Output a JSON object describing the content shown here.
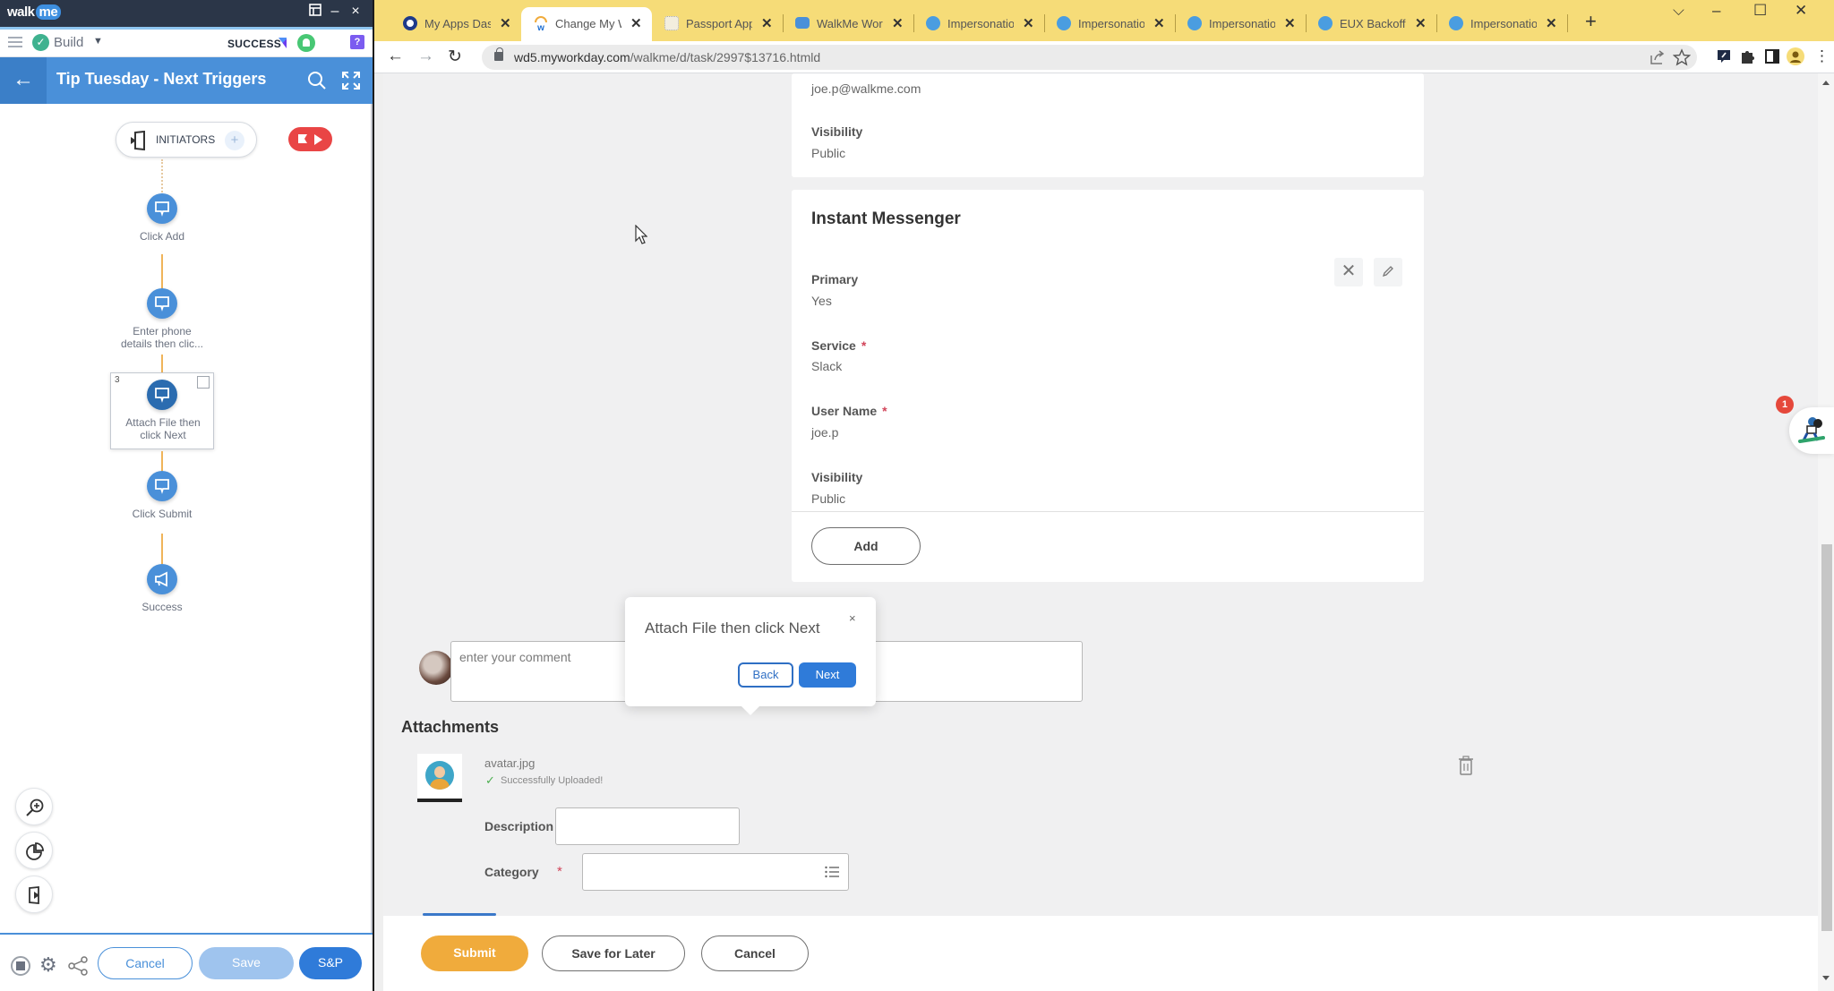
{
  "walkme": {
    "logo": "walk",
    "logo_me": "me",
    "build_label": "Build",
    "success_label": "SUCCESS",
    "help_label": "?",
    "flow_title": "Tip Tuesday - Next Triggers",
    "initiators_label": "INITIATORS",
    "initiators_add": "+",
    "steps": [
      {
        "label": "Click Add",
        "icon": "balloon-icon"
      },
      {
        "label": "Enter phone details then clic...",
        "icon": "balloon-icon"
      },
      {
        "label": "Attach File then click Next",
        "icon": "balloon-icon",
        "number": "3",
        "selected": true
      },
      {
        "label": "Click Submit",
        "icon": "balloon-icon"
      },
      {
        "label": "Success",
        "icon": "megaphone-icon"
      }
    ],
    "footer": {
      "cancel": "Cancel",
      "save": "Save",
      "save_publish": "S&P"
    }
  },
  "browser": {
    "tabs": [
      {
        "title": "My Apps Dashboard",
        "icon": "okta-icon",
        "active": false
      },
      {
        "title": "Change My Work Contact",
        "icon": "workday-icon",
        "active": true
      },
      {
        "title": "Passport Application",
        "icon": "passport-icon",
        "active": false
      },
      {
        "title": "WalkMe Workstation",
        "icon": "walkme-icon",
        "active": false
      },
      {
        "title": "Impersonation",
        "icon": "workday-w-icon",
        "active": false
      },
      {
        "title": "Impersonation",
        "icon": "workday-w-icon",
        "active": false
      },
      {
        "title": "Impersonation",
        "icon": "workday-w-icon",
        "active": false
      },
      {
        "title": "EUX Backoffice",
        "icon": "workday-w-icon",
        "active": false
      },
      {
        "title": "Impersonation",
        "icon": "workday-w-icon",
        "active": false
      }
    ],
    "url_host": "wd5.myworkday.com",
    "url_path": "/walkme/d/task/2997$13716.htmld",
    "brand_colors": {
      "tabstrip": "#f6dc78",
      "workday_primary": "#f0ab3c"
    }
  },
  "page": {
    "email_card": {
      "email_value": "joe.p@walkme.com",
      "visibility_label": "Visibility",
      "visibility_value": "Public"
    },
    "im_card": {
      "title": "Instant Messenger",
      "primary_label": "Primary",
      "primary_value": "Yes",
      "service_label": "Service",
      "service_value": "Slack",
      "username_label": "User Name",
      "username_value": "joe.p",
      "visibility_label": "Visibility",
      "visibility_value": "Public",
      "required_mark": "*",
      "add_button": "Add"
    },
    "comment_placeholder": "enter your comment",
    "attachments": {
      "heading": "Attachments",
      "file_name": "avatar.jpg",
      "status": "Successfully Uploaded!",
      "description_label": "Description",
      "description_value": "",
      "category_label": "Category",
      "category_value": "",
      "required_mark": "*"
    },
    "actions": {
      "submit": "Submit",
      "save_for_later": "Save for Later",
      "cancel": "Cancel"
    }
  },
  "balloon": {
    "title": "Attach File then click Next",
    "close": "×",
    "back": "Back",
    "next": "Next"
  },
  "launcher": {
    "badge_count": "1"
  }
}
